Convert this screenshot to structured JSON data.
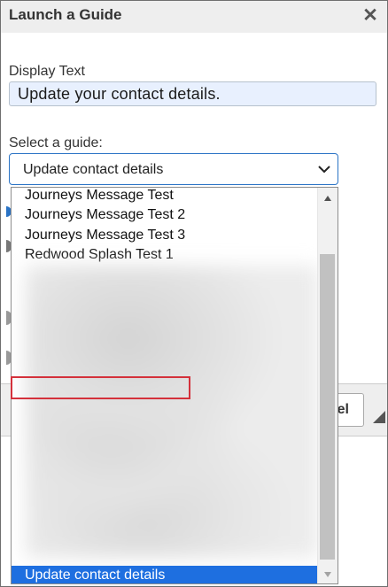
{
  "dialog": {
    "title": "Launch a Guide",
    "close_icon": "close-icon"
  },
  "form": {
    "display_text_label": "Display Text",
    "display_text_value": "Update your contact details.",
    "select_label": "Select a guide:",
    "select_value": "Update contact details",
    "cancel_label": "el"
  },
  "dropdown": {
    "options": [
      "Journeys Message Test",
      "Journeys Message Test 2",
      "Journeys Message Test 3",
      "Redwood Splash Test 1"
    ],
    "selected_option": "Update contact details"
  },
  "colors": {
    "selected_bg": "#1e6fe0",
    "highlight_border": "#d4313b",
    "select_border": "#2a73c5",
    "input_bg": "#e8f0fe"
  }
}
